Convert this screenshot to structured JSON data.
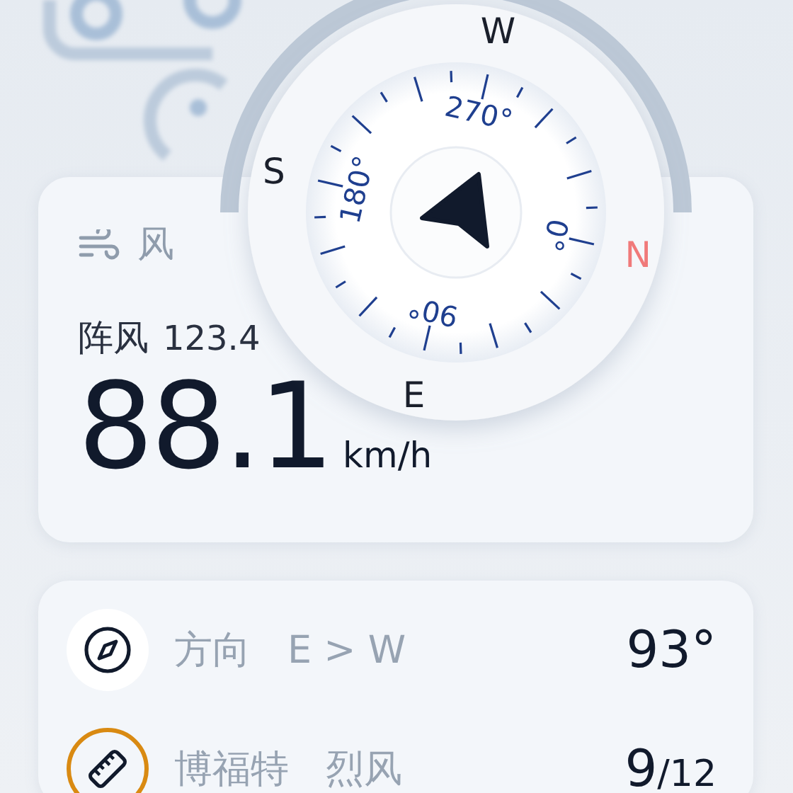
{
  "compass": {
    "cardinals": [
      {
        "label": "N",
        "color": "#f07a7a"
      },
      {
        "label": "E",
        "color": "#1a1f2b"
      },
      {
        "label": "S",
        "color": "#1a1f2b"
      },
      {
        "label": "W",
        "color": "#1a1f2b"
      }
    ],
    "degrees": [
      "0°",
      "90°",
      "180°",
      "270°"
    ]
  },
  "wind": {
    "title": "风",
    "gust_label": "阵风",
    "gust_value": "123.4",
    "speed": "88.1",
    "unit": "km/h"
  },
  "details": [
    {
      "kind": "compass",
      "label": "方向",
      "value": "E > W",
      "reading": "93°"
    },
    {
      "kind": "ruler",
      "label": "博福特",
      "value": "烈风",
      "reading": "9",
      "reading_max": "/12"
    }
  ]
}
